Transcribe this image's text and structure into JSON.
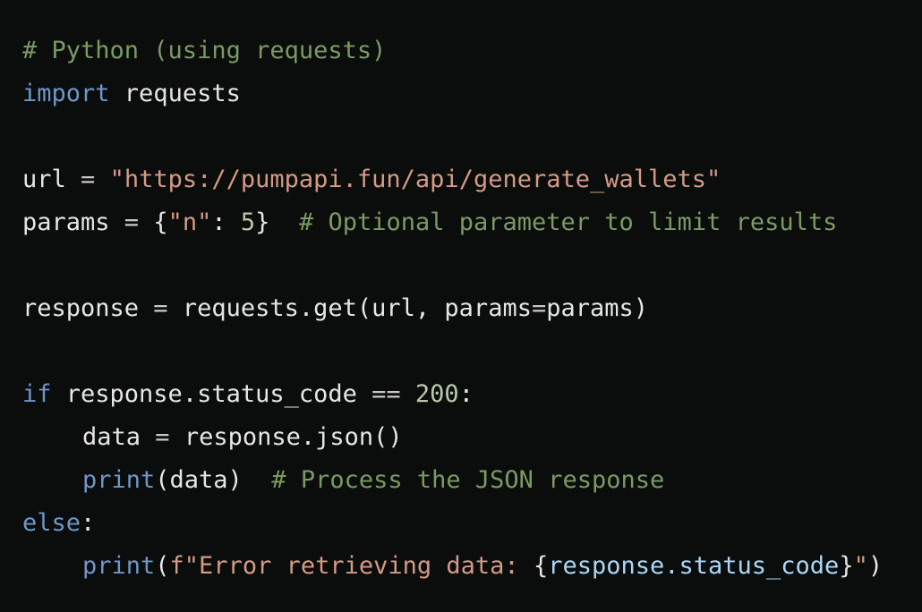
{
  "code": {
    "line1": {
      "comment": "# Python (using requests)"
    },
    "line2": {
      "keyword": "import",
      "module": " requests"
    },
    "line4": {
      "var": "url",
      "op": " = ",
      "string": "\"https://pumpapi.fun/api/generate_wallets\""
    },
    "line5": {
      "var": "params",
      "op": " = ",
      "brace_open": "{",
      "key": "\"n\"",
      "colon": ": ",
      "number": "5",
      "brace_close": "}",
      "spacer": "  ",
      "comment": "# Optional parameter to limit results"
    },
    "line7": {
      "var": "response",
      "op": " = ",
      "call": "requests.get(url, params",
      "eq": "=",
      "rest": "params)"
    },
    "line9": {
      "keyword": "if",
      "cond": " response.status_code ",
      "op": "==",
      "sp": " ",
      "number": "200",
      "colon": ":"
    },
    "line10": {
      "var": "data",
      "op": " = ",
      "call": "response.json()"
    },
    "line11": {
      "builtin": "print",
      "args": "(data)",
      "spacer": "  ",
      "comment": "# Process the JSON response"
    },
    "line12": {
      "keyword": "else",
      "colon": ":"
    },
    "line13": {
      "builtin": "print",
      "paren_open": "(",
      "fstring_start": "f\"Error retrieving data: ",
      "interp_open": "{",
      "interp": "response.status_code",
      "interp_close": "}",
      "fstring_end": "\"",
      "paren_close": ")"
    }
  },
  "colors": {
    "background": "#0b0c0c",
    "comment": "#7a9a63",
    "keyword": "#6f96c9",
    "string": "#d49a86",
    "number": "#b7c9a8",
    "text": "#e6e6e6"
  }
}
